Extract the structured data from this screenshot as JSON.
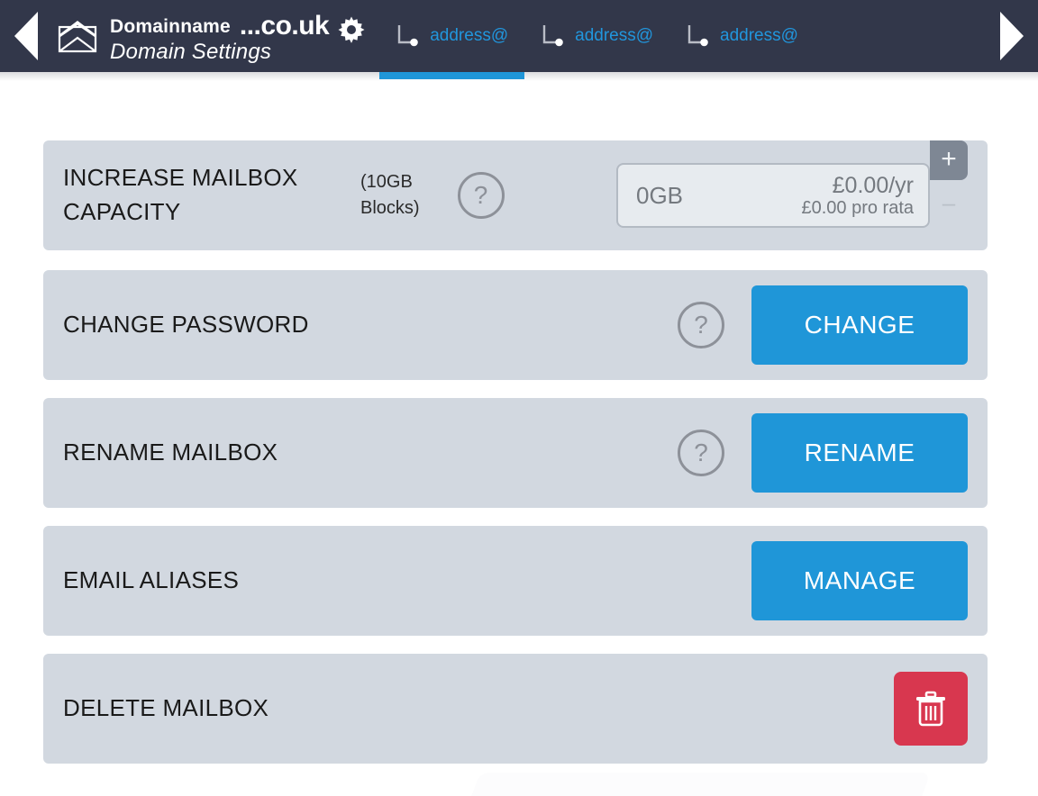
{
  "header": {
    "prev_arrow": "◀",
    "next_arrow": "▶",
    "mail_icon": "envelope-icon",
    "gear_icon": "gear-icon",
    "domain_name": "Domainname",
    "domain_tld": "...co.uk",
    "subtitle": "Domain Settings",
    "background_color": "#32374a",
    "accent_color": "#1f96d8",
    "tabs": [
      {
        "label": "address@",
        "icon": "mailbox-branch-icon",
        "active": true
      },
      {
        "label": "address@",
        "icon": "mailbox-branch-icon",
        "active": false
      },
      {
        "label": "address@",
        "icon": "mailbox-branch-icon",
        "active": false
      }
    ]
  },
  "colors": {
    "panel": "#d2d8e0",
    "primary_button": "#1f96d8",
    "danger_button": "#d8374f",
    "help_outline": "#8d9199",
    "field_background": "#e7ebef",
    "stepper": "#7e8794"
  },
  "rows": {
    "capacity": {
      "title": "INCREASE MAILBOX\nCAPACITY",
      "note": "(10GB\nBlocks)",
      "help_label": "?",
      "field": {
        "value": "0GB",
        "price_main": "£0.00/yr",
        "price_sub": "£0.00 pro rata"
      },
      "stepper": {
        "increment_label": "+",
        "decrement_label": "–"
      }
    },
    "password": {
      "title": "CHANGE PASSWORD",
      "help_label": "?",
      "button_label": "CHANGE"
    },
    "rename": {
      "title": "RENAME MAILBOX",
      "help_label": "?",
      "button_label": "RENAME"
    },
    "aliases": {
      "title": "EMAIL ALIASES",
      "button_label": "MANAGE"
    },
    "delete": {
      "title": "DELETE MAILBOX",
      "button_icon": "trash-icon"
    }
  }
}
